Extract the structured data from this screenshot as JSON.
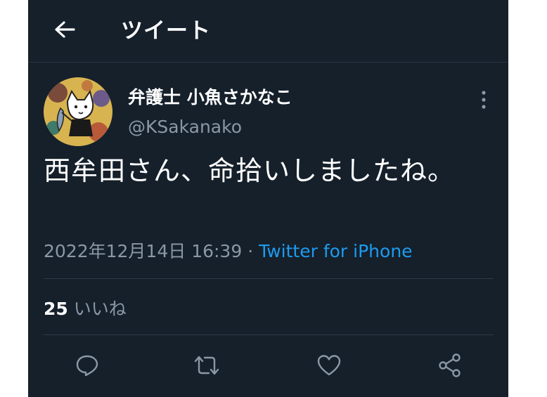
{
  "header": {
    "back_icon": "arrow-left-icon",
    "title": "ツイート"
  },
  "author": {
    "display_name": "弁護士 小魚さかなこ",
    "handle": "@KSakanako"
  },
  "tweet": {
    "text": "西牟田さん、命拾いしましたね。",
    "timestamp": "2022年12月14日 16:39",
    "separator": " · ",
    "source": "Twitter for iPhone"
  },
  "stats": {
    "likes_count": "25",
    "likes_label": "いいね"
  },
  "actions": {
    "reply_icon": "reply-icon",
    "retweet_icon": "retweet-icon",
    "like_icon": "heart-icon",
    "share_icon": "share-icon"
  },
  "colors": {
    "background": "#15202b",
    "secondary_text": "#8b98a5",
    "link": "#1d9bf0"
  }
}
